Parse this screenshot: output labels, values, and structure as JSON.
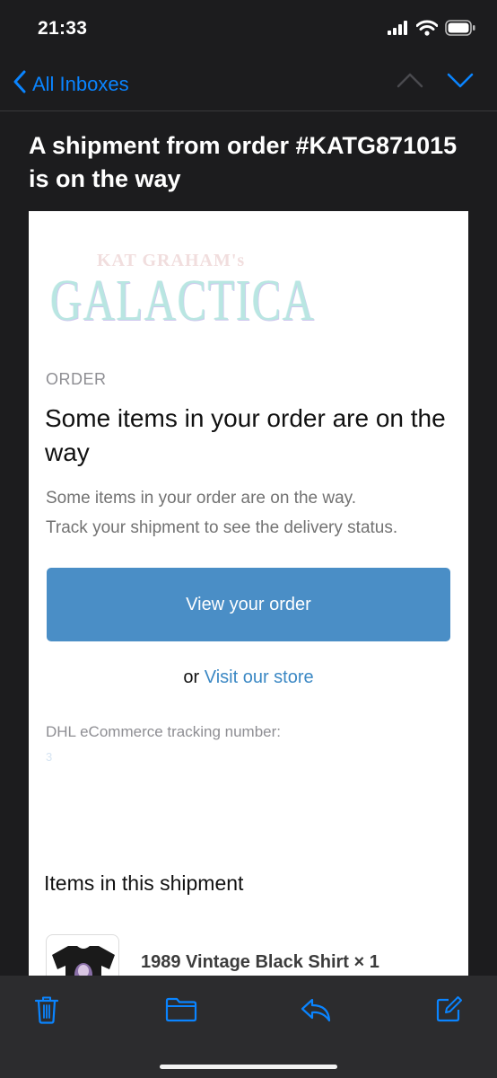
{
  "status": {
    "time": "21:33",
    "icons": [
      "cellular-signal-icon",
      "wifi-icon",
      "battery-icon"
    ]
  },
  "nav": {
    "back_label": "All Inboxes",
    "icons": [
      "chevron-left-icon",
      "chevron-up-icon",
      "chevron-down-icon"
    ]
  },
  "subject": "A shipment from order #KATG871015 is on the way",
  "email": {
    "logo_top": "KAT GRAHAM's",
    "logo_main": "GALACTICA",
    "eyebrow": "ORDER",
    "headline": "Some items in your order are on the way",
    "body_line1": "Some items in your order are on the way.",
    "body_line2": "Track your shipment to see the delivery status.",
    "cta_label": "View your order",
    "store_prefix": "or",
    "store_link": "Visit our store",
    "tracking_label": "DHL eCommerce tracking number:",
    "tracking_number": "3",
    "items_heading": "Items in this shipment",
    "items": [
      {
        "title": "1989 Vintage Black Shirt × 1"
      }
    ]
  },
  "toolbar": {
    "icons": [
      "trash-icon",
      "folder-icon",
      "reply-icon",
      "compose-icon"
    ]
  },
  "colors": {
    "accent": "#0a84ff",
    "background": "#1c1c1e",
    "toolbar": "#2c2c2e",
    "cta": "#4a8ec6",
    "link": "#3b88c4"
  }
}
